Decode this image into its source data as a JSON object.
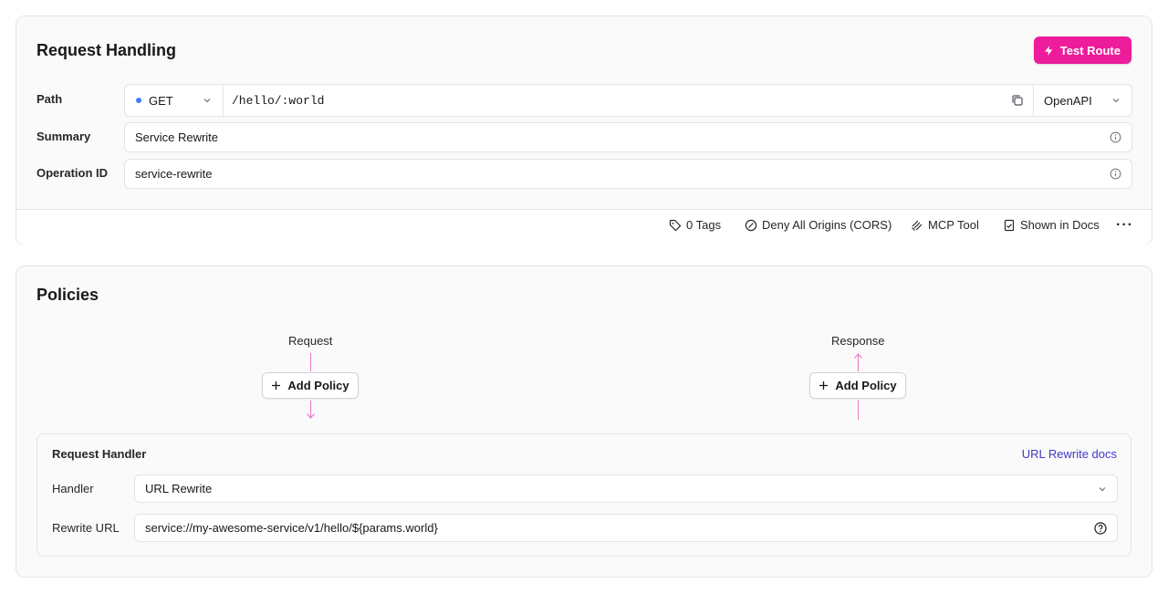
{
  "request_handling": {
    "title": "Request Handling",
    "test_button_label": "Test Route",
    "path_label": "Path",
    "method": "GET",
    "path_value": "/hello/:world",
    "openapi_label": "OpenAPI",
    "summary_label": "Summary",
    "summary_value": "Service Rewrite",
    "operation_id_label": "Operation ID",
    "operation_id_value": "service-rewrite",
    "footer": {
      "tags": "0 Tags",
      "cors": "Deny All Origins (CORS)",
      "mcp": "MCP Tool",
      "docs": "Shown in Docs"
    }
  },
  "policies": {
    "title": "Policies",
    "request_label": "Request",
    "response_label": "Response",
    "add_policy_label": "Add Policy",
    "request_handler": {
      "title": "Request Handler",
      "docs_link": "URL Rewrite docs",
      "handler_label": "Handler",
      "handler_value": "URL Rewrite",
      "rewrite_url_label": "Rewrite URL",
      "rewrite_url_value": "service://my-awesome-service/v1/hello/${params.world}"
    }
  },
  "colors": {
    "accent": "#ec1c9a",
    "flow_line": "#e879c7",
    "method_dot": "#3b82f6",
    "link": "#4338ca"
  }
}
